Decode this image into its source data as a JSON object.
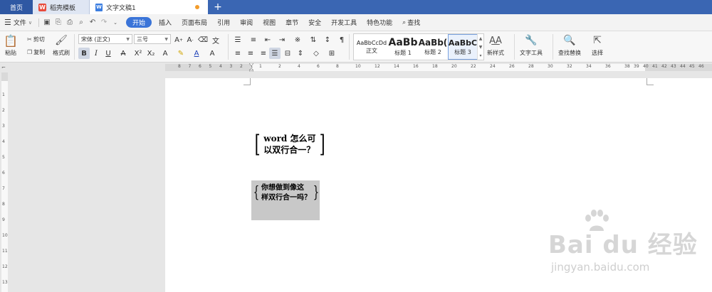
{
  "tabs": {
    "home": "首页",
    "templates": "稻壳模板",
    "document": "文字文稿1",
    "new_tab": "+"
  },
  "menu": {
    "file": "文件",
    "file_arrow": "∨",
    "tabs": [
      "开始",
      "插入",
      "页面布局",
      "引用",
      "审阅",
      "视图",
      "章节",
      "安全",
      "开发工具",
      "特色功能"
    ],
    "active_tab": "开始",
    "search": "查找"
  },
  "ribbon": {
    "paste": "粘贴",
    "cut": "剪切",
    "copy": "复制",
    "format_painter": "格式刷",
    "font_name": "宋体 (正文)",
    "font_size": "三号",
    "bold": "B",
    "italic": "I",
    "underline": "U",
    "styles": [
      {
        "sample": "AaBbCcDd",
        "label": "正文"
      },
      {
        "sample": "AaBb",
        "label": "标题 1"
      },
      {
        "sample": "AaBb(",
        "label": "标题 2"
      },
      {
        "sample": "AaBbC",
        "label": "标题 3"
      }
    ],
    "selected_style": "标题 3",
    "new_style": "新样式",
    "text_tools": "文字工具",
    "find_replace": "查找替换",
    "select": "选择"
  },
  "ruler": {
    "left_numbers": [
      "8",
      "7",
      "6",
      "5",
      "4",
      "3",
      "2",
      "1"
    ],
    "right_numbers": [
      "1",
      "2",
      "4",
      "6",
      "8",
      "10",
      "12",
      "14",
      "16",
      "18",
      "20",
      "22",
      "24",
      "26",
      "28",
      "30",
      "32",
      "34",
      "36",
      "38",
      "39",
      "40",
      "41",
      "42",
      "43",
      "44",
      "45",
      "46"
    ],
    "vertical_numbers": [
      "1",
      "2",
      "3",
      "4",
      "5",
      "6",
      "7",
      "8",
      "9",
      "10",
      "11",
      "12",
      "13",
      "14"
    ]
  },
  "document": {
    "combined_1_line1": "word 怎么可",
    "combined_1_line2": "以双行合一？",
    "combined_2_line1": "你想做到像这",
    "combined_2_line2": "样双行合一吗？"
  },
  "watermark": {
    "brand": "Bai du 经验",
    "url": "jingyan.baidu.com"
  },
  "colors": {
    "tabbar": "#3a66b3",
    "active_tab": "#3a74d8",
    "highlight_bg": "#c8c8c8"
  }
}
